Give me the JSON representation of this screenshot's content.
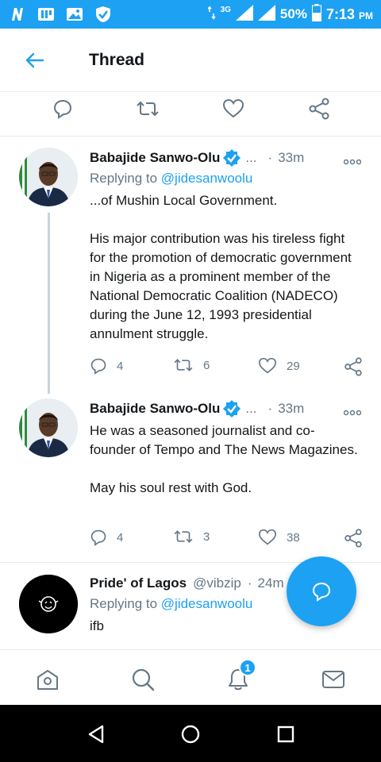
{
  "status_bar": {
    "network": "3G",
    "battery": "50%",
    "time": "7:13",
    "ampm": "PM"
  },
  "header": {
    "title": "Thread"
  },
  "tweets": [
    {
      "name": "Babajide Sanwo-Olu",
      "handle": "...",
      "time": "33m",
      "replying_prefix": "Replying to ",
      "replying_handle": "@jidesanwoolu",
      "paragraphs": [
        "...of Mushin Local Government.",
        "His major contribution was his tireless fight for the promotion of democratic government in Nigeria as a prominent member of the National Democratic Coalition (NADECO) during the June 12, 1993 presidential annulment struggle."
      ],
      "replies": "4",
      "retweets": "6",
      "likes": "29"
    },
    {
      "name": "Babajide Sanwo-Olu",
      "handle": "...",
      "time": "33m",
      "paragraphs": [
        "He was a seasoned journalist and co-founder of Tempo and The News Magazines.",
        "May his soul rest with God."
      ],
      "replies": "4",
      "retweets": "3",
      "likes": "38"
    },
    {
      "name": "Pride' of Lagos",
      "handle": "@vibzip",
      "time": "24m",
      "replying_prefix": "Replying to ",
      "replying_handle": "@jidesanwoolu",
      "paragraphs": [
        "ifb"
      ]
    }
  ],
  "bottom_nav": {
    "notification_badge": "1"
  },
  "colors": {
    "accent": "#1da1f2",
    "text": "#14171a",
    "secondary": "#657786"
  }
}
